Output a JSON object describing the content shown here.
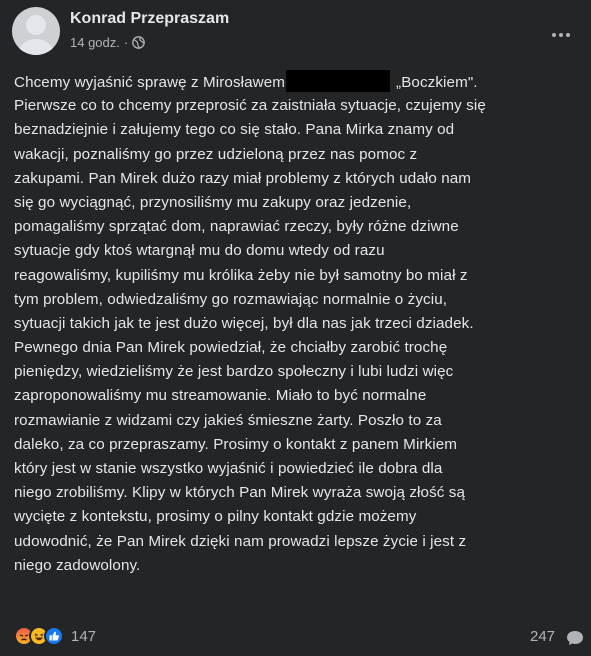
{
  "post": {
    "author": "Konrad Przepraszam",
    "time": "14 godz.",
    "separator": "·",
    "privacy_icon": "globe-icon",
    "body_lines": [
      [
        "Chcemy wyjaśnić sprawę z Mirosławem",
        "„Boczkiem\"."
      ],
      "Pierwsze co to chcemy przeprosić za zaistniała sytuacje, czujemy się",
      "beznadziejnie i załujemy tego co się stało. Pana Mirka znamy od",
      "wakacji, poznaliśmy go przez udzieloną przez nas pomoc z",
      "zakupami. Pan Mirek dużo razy miał problemy z których udało nam",
      "się go wyciągnąć, przynosiliśmy mu zakupy oraz jedzenie,",
      "pomagaliśmy sprzątać dom, naprawiać rzeczy, były różne dziwne",
      "sytuacje gdy ktoś wtargnął mu do domu wtedy od razu",
      "reagowaliśmy, kupiliśmy mu królika żeby nie był samotny bo miał z",
      "tym problem, odwiedzaliśmy go rozmawiając normalnie o życiu,",
      "sytuacji takich jak te jest dużo więcej, był dla nas jak trzeci dziadek.",
      "Pewnego dnia Pan Mirek powiedział, że chciałby zarobić trochę",
      "pieniędzy, wiedzieliśmy że jest bardzo społeczny i lubi ludzi więc",
      "zaproponowaliśmy mu streamowanie. Miało to być normalne",
      "rozmawianie z widzami czy jakieś śmieszne żarty. Poszło to za",
      "daleko, za co przepraszamy. Prosimy o kontakt z panem Mirkiem",
      "który jest w stanie wszystko wyjaśnić i powiedzieć ile dobra dla",
      "niego zrobiliśmy. Klipy w których Pan Mirek wyraża swoją złość są",
      "wycięte z kontekstu, prosimy o pilny kontakt gdzie możemy",
      "udowodnić, że Pan Mirek dzięki nam prowadzi lepsze życie i jest z",
      "niego zadowolony."
    ]
  },
  "footer": {
    "reaction_icons": [
      "angry-reaction-icon",
      "haha-reaction-icon",
      "like-reaction-icon"
    ],
    "reaction_count": "147",
    "comment_count": "247",
    "comment_icon": "comment-icon"
  },
  "colors": {
    "background": "#242526",
    "text": "#e4e6eb",
    "secondary_text": "#b0b3b8",
    "like_blue": "#1877f2"
  }
}
